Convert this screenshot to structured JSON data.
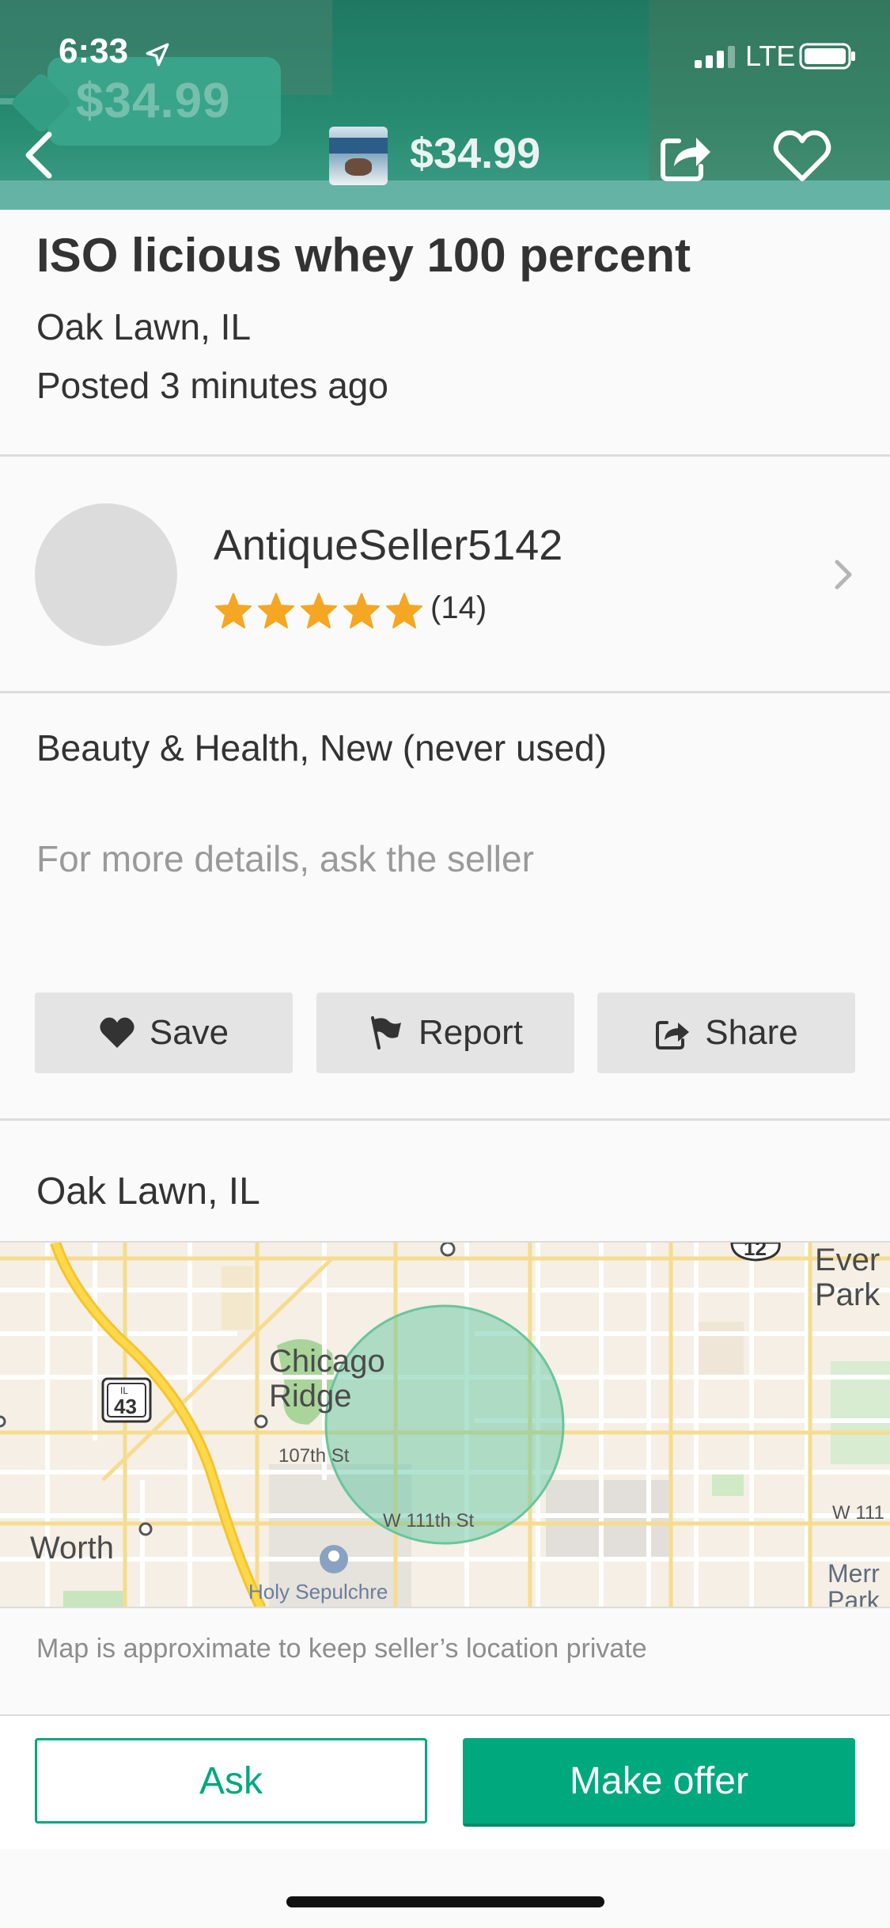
{
  "status_bar": {
    "time": "6:33",
    "network": "LTE"
  },
  "header": {
    "price_tag_text": "$34.99",
    "price": "$34.99"
  },
  "listing": {
    "title": "ISO licious whey 100 percent",
    "location": "Oak Lawn, IL",
    "posted": "Posted 3 minutes ago"
  },
  "seller": {
    "name": "AntiqueSeller5142",
    "rating": 5,
    "review_count": "(14)"
  },
  "details": {
    "category_condition": "Beauty & Health, New (never used)",
    "description_placeholder": "For more details, ask the seller"
  },
  "actions": {
    "save": "Save",
    "report": "Report",
    "share": "Share"
  },
  "map_section": {
    "location": "Oak Lawn, IL",
    "note": "Map is approximate to keep seller’s location private",
    "labels": {
      "chicago_ridge_1": "Chicago",
      "chicago_ridge_2": "Ridge",
      "worth": "Worth",
      "street_107": "107th St",
      "street_111": "W 111th St",
      "holy_sepulchre": "Holy Sepulchre",
      "route_il": "IL",
      "route_43": "43",
      "route_12": "12",
      "ever_1": "Ever",
      "park_1": "Park",
      "w111_edge": "W 111",
      "merr": "Merr",
      "park_2": "Park"
    }
  },
  "bottom": {
    "ask": "Ask",
    "make_offer": "Make offer"
  },
  "colors": {
    "brand_green": "#00a87e",
    "star": "#f5a623",
    "header_teal": "#278c72",
    "radius_circle": "#7ed0b0"
  }
}
